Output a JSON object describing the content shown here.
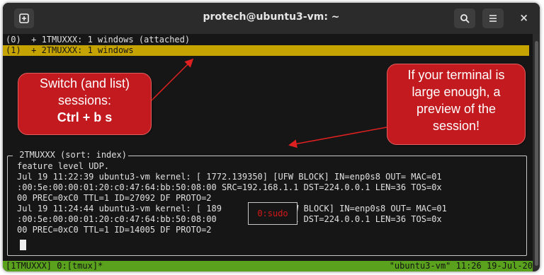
{
  "titlebar": {
    "title": "protech@ubuntu3-vm: ~",
    "new_tab_icon": "new-tab-icon",
    "search_icon": "search-icon",
    "menu_icon": "hamburger-menu-icon",
    "close_label": "×"
  },
  "session_list": [
    {
      "text": "(0)  + 1TMUXXX: 1 windows (attached)"
    },
    {
      "text": "(1)  + 2TMUXXX: 1 windows"
    }
  ],
  "preview": {
    "title": " 2TMUXXX (sort: index)",
    "lines": [
      "feature level UDP.",
      "Jul 19 11:22:39 ubuntu3-vm kernel: [ 1772.139350] [UFW BLOCK] IN=enp0s8 OUT= MAC=01",
      ":00:5e:00:00:01:20:c0:47:64:bb:50:08:00 SRC=192.168.1.1 DST=224.0.0.1 LEN=36 TOS=0x",
      "00 PREC=0xC0 TTL=1 ID=27092 DF PROTO=2",
      "Jul 19 11:24:44 ubuntu3-vm kernel: [ 189           [UFW BLOCK] IN=enp0s8 OUT= MAC=01",
      ":00:5e:00:00:01:20:c0:47:64:bb:50:08:00           8.1.1 DST=224.0.0.1 LEN=36 TOS=0x",
      "00 PREC=0xC0 TTL=1 ID=14005 DF PROTO=2"
    ],
    "window_label": "0:sudo"
  },
  "status_bar": {
    "left": "[1TMUXXX] 0:[tmux]*",
    "right": "\"ubuntu3-vm\" 11:26 19-Jul-20"
  },
  "callouts": {
    "left": {
      "line1": "Switch (and list)",
      "line2": "sessions:",
      "line3": "Ctrl + b s"
    },
    "right": {
      "line1": "If your terminal is",
      "line2": "large enough, a",
      "line3": "preview of the",
      "line4": "session!"
    }
  },
  "colors": {
    "highlight": "#c5a300",
    "status_bar": "#5aa11e",
    "callout": "#c21a1e",
    "terminal_bg": "#161616"
  }
}
